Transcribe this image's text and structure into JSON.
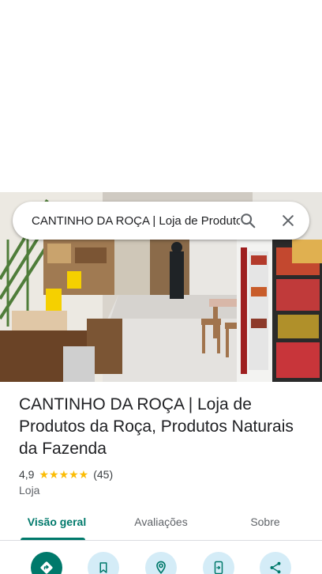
{
  "search": {
    "query": "CANTINHO DA ROÇA | Loja de Produtos da Roça, Produtos Naturais da Fazenda"
  },
  "place": {
    "title": "CANTINHO DA ROÇA | Loja de Produtos da Roça, Produtos Naturais da Fazenda",
    "rating": "4,9",
    "stars": "★★★★★",
    "rating_fraction": 0.98,
    "review_count": "(45)",
    "category": "Loja"
  },
  "tabs": [
    {
      "label": "Visão geral",
      "active": true
    },
    {
      "label": "Avaliações",
      "active": false
    },
    {
      "label": "Sobre",
      "active": false
    }
  ],
  "actions": [
    {
      "icon": "directions-icon"
    },
    {
      "icon": "bookmark-icon"
    },
    {
      "icon": "nearby-icon"
    },
    {
      "icon": "send-to-phone-icon"
    },
    {
      "icon": "share-icon"
    }
  ],
  "colors": {
    "accent": "#00796b",
    "action_bg": "#d4ecf7",
    "star": "#fbbc04"
  }
}
